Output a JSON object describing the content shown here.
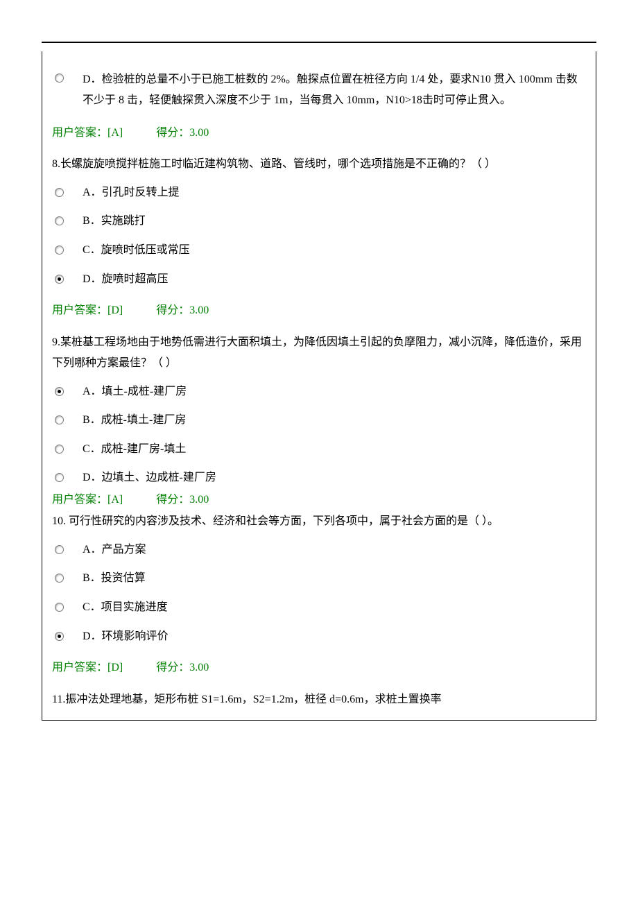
{
  "strings": {
    "answer_label": "用户答案：",
    "score_label": "得分：",
    "blank": "（   ）"
  },
  "hr_line": "",
  "q7": {
    "option_d": "D．检验桩的总量不小于已施工桩数的 2%。触探点位置在桩径方向 1/4 处，要求N10 贯入 100mm 击数不少于 8 击，轻便触探贯入深度不少于 1m，当每贯入 10mm，N10>18击时可停止贯入。",
    "answer_key": "[A]",
    "score": "3.00"
  },
  "q8": {
    "prompt": "8.长螺旋旋喷搅拌桩施工时临近建构筑物、道路、管线时，哪个选项措施是不正确的？（   ）",
    "a": "A．引孔时反转上提",
    "b": "B．实施跳打",
    "c": "C．旋喷时低压或常压",
    "d": "D．旋喷时超高压",
    "answer_key": "[D]",
    "score": "3.00"
  },
  "q9": {
    "prompt": "9.某桩基工程场地由于地势低需进行大面积填土，为降低因填土引起的负摩阻力，减小沉降，降低造价，采用下列哪种方案最佳？（   ）",
    "a": "A．填土-成桩-建厂房",
    "b": "B．成桩-填土-建厂房",
    "c": "C．成桩-建厂房-填土",
    "d": "D．边填土、边成桩-建厂房",
    "answer_key": "[A]",
    "score": "3.00"
  },
  "q10": {
    "prompt": "10. 可行性研究的内容涉及技术、经济和社会等方面，下列各项中，属于社会方面的是（    ）。",
    "a": "A．产品方案",
    "b": "B．投资估算",
    "c": "C．项目实施进度",
    "d": "D．环境影响评价",
    "answer_key": "[D]",
    "score": "3.00"
  },
  "q11": {
    "prompt": "11.振冲法处理地基，矩形布桩 S1=1.6m，S2=1.2m，桩径 d=0.6m，求桩土置换率"
  }
}
